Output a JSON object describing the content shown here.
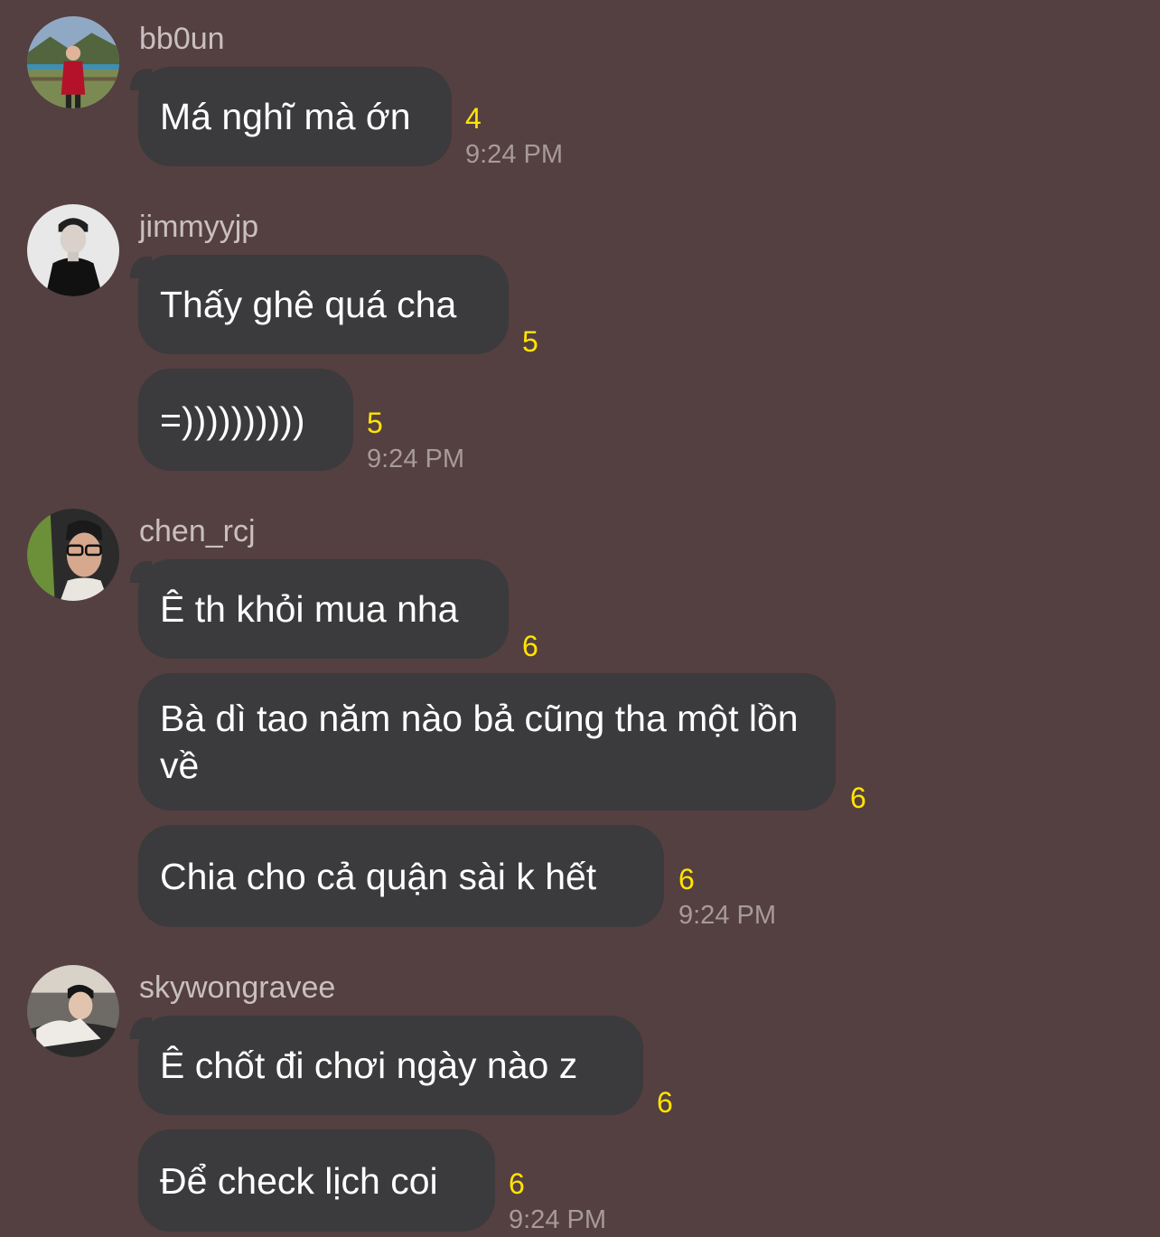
{
  "conversation": {
    "groups": [
      {
        "sender": "bb0un",
        "avatar_icon": "avatar-photo-bb0un",
        "messages": [
          {
            "text": "Má nghĩ mà ớn",
            "count": "4",
            "time": "9:24 PM"
          }
        ]
      },
      {
        "sender": "jimmyyjp",
        "avatar_icon": "avatar-photo-jimmyyjp",
        "messages": [
          {
            "text": "Thấy ghê quá cha",
            "count": "5",
            "time": ""
          },
          {
            "text": "=))))))))))",
            "count": "5",
            "time": "9:24 PM"
          }
        ]
      },
      {
        "sender": "chen_rcj",
        "avatar_icon": "avatar-photo-chen-rcj",
        "messages": [
          {
            "text": "Ê th khỏi mua nha",
            "count": "6",
            "time": ""
          },
          {
            "text": "Bà dì tao năm nào bả cũng tha một lồn về",
            "count": "6",
            "time": ""
          },
          {
            "text": "Chia cho cả quận sài k hết",
            "count": "6",
            "time": "9:24 PM"
          }
        ]
      },
      {
        "sender": "skywongravee",
        "avatar_icon": "avatar-photo-skywongravee",
        "messages": [
          {
            "text": "Ê chốt đi chơi ngày nào z",
            "count": "6",
            "time": ""
          },
          {
            "text": "Để check lịch coi",
            "count": "6",
            "time": "9:24 PM"
          }
        ]
      }
    ]
  },
  "colors": {
    "background": "#543f41",
    "bubble": "#3b3a3c",
    "message_text": "#ffffff",
    "sender_text": "#c9bfc0",
    "unread_count": "#ffe500",
    "timestamp": "#a79a9b"
  }
}
